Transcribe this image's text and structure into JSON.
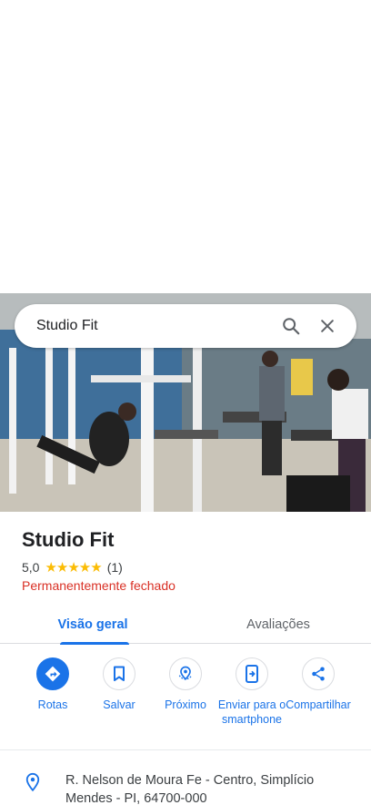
{
  "search": {
    "query": "Studio Fit",
    "search_icon": "search-icon",
    "clear_icon": "close-icon"
  },
  "place": {
    "name": "Studio Fit",
    "rating": "5,0",
    "stars": "★★★★★",
    "review_count": "(1)",
    "status": "Permanentemente fechado",
    "status_color": "#d93025"
  },
  "tabs": [
    {
      "label": "Visão geral",
      "active": true
    },
    {
      "label": "Avaliações",
      "active": false
    }
  ],
  "actions": [
    {
      "label": "Rotas",
      "icon": "directions-icon"
    },
    {
      "label": "Salvar",
      "icon": "bookmark-icon"
    },
    {
      "label": "Próximo",
      "icon": "nearby-icon"
    },
    {
      "label": "Enviar para o smartphone",
      "icon": "send-to-phone-icon"
    },
    {
      "label": "Compartilhar",
      "icon": "share-icon"
    }
  ],
  "address": {
    "icon": "location-pin-icon",
    "text": "R. Nelson de Moura Fe - Centro, Simplício Mendes - PI, 64700-000"
  },
  "colors": {
    "accent": "#1a73e8",
    "star": "#fbbc04",
    "closed": "#d93025"
  }
}
